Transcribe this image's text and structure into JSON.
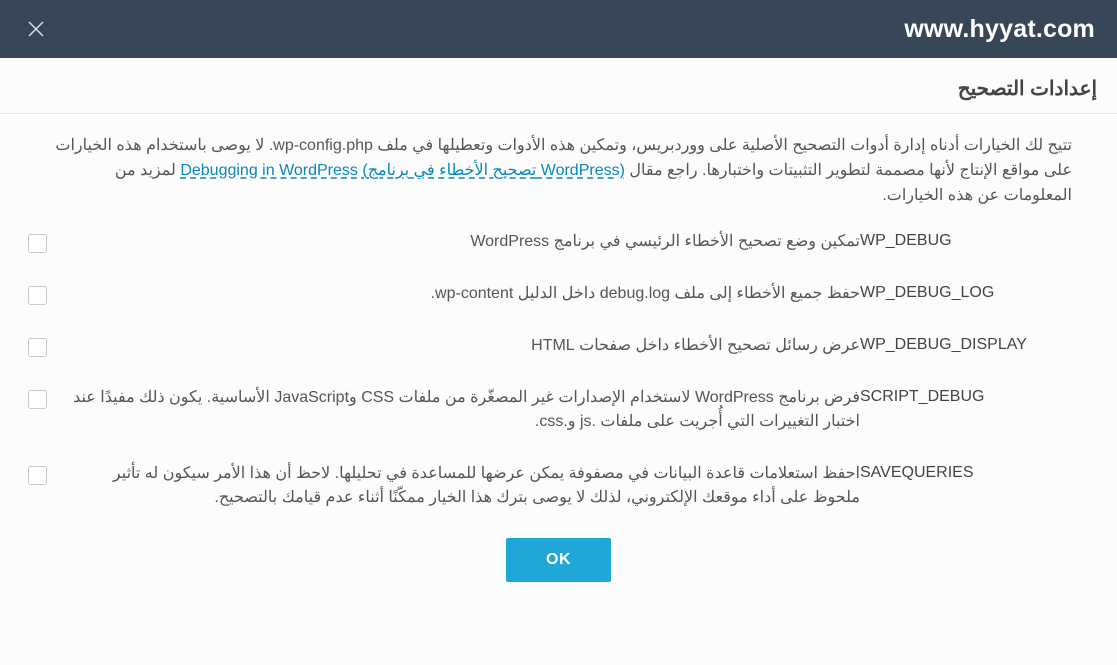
{
  "header": {
    "site_title": "www.hyyat.com"
  },
  "page": {
    "title": "إعدادات التصحيح",
    "intro_before_link": "تتيح لك الخيارات أدناه إدارة أدوات التصحيح الأصلية على ووردبريس، وتمكين هذه الأدوات وتعطيلها في ملف wp-config.php. لا يوصى باستخدام هذه الخيارات على مواقع الإنتاج لأنها مصممة لتطوير التثبيتات واختبارها. راجع مقال ",
    "link_text": "Debugging in WordPress (تصحيح الأخطاء في برنامج WordPress)",
    "intro_after_link": " لمزيد من المعلومات عن هذه الخيارات."
  },
  "options": [
    {
      "name": "WP_DEBUG",
      "desc": "تمكين وضع تصحيح الأخطاء الرئيسي في برنامج WordPress"
    },
    {
      "name": "WP_DEBUG_LOG",
      "desc": "حفظ جميع الأخطاء إلى ملف debug.log داخل الدليل wp-content."
    },
    {
      "name": "WP_DEBUG_DISPLAY",
      "desc": "عرض رسائل تصحيح الأخطاء داخل صفحات HTML"
    },
    {
      "name": "SCRIPT_DEBUG",
      "desc": "فرض برنامج WordPress لاستخدام الإصدارات غير المصغّرة من ملفات CSS وJavaScript الأساسية. يكون ذلك مفيدًا عند اختبار التغييرات التي أُجريت على ملفات .js و.css."
    },
    {
      "name": "SAVEQUERIES",
      "desc": "احفظ استعلامات قاعدة البيانات في مصفوفة يمكن عرضها للمساعدة في تحليلها. لاحظ أن هذا الأمر سيكون له تأثير ملحوظ على أداء موقعك الإلكتروني، لذلك لا يوصى بترك هذا الخيار ممكّنًا أثناء عدم قيامك بالتصحيح."
    }
  ],
  "footer": {
    "ok": "OK"
  }
}
